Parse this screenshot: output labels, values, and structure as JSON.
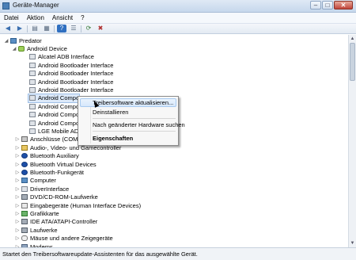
{
  "window": {
    "title": "Geräte-Manager",
    "min": "–",
    "max": "□",
    "close": "✕"
  },
  "menu": [
    "Datei",
    "Aktion",
    "Ansicht",
    "?"
  ],
  "toolbar": [
    "back-icon",
    "forward-icon",
    "view-icon",
    "properties-icon",
    "help-icon",
    "list-icon",
    "scan-icon",
    "uninstall-icon"
  ],
  "tree": {
    "root": "Predator",
    "android": {
      "label": "Android Device",
      "children": [
        "Alcatel ADB Interface",
        "Android Bootloader Interface",
        "Android Bootloader Interface",
        "Android Bootloader Interface",
        "Android Bootloader Interface",
        "Android Compo",
        "Android Compo",
        "Android Compo",
        "Android Compo",
        "LGE Mobile ADB"
      ],
      "selected_index": 5
    },
    "categories": [
      "Anschlüsse (COM & LPT)",
      "Audio-, Video- und Gamecontroller",
      "Bluetooth Auxiliary",
      "Bluetooth Virtual Devices",
      "Bluetooth-Funkgerät",
      "Computer",
      "DriverInterface",
      "DVD/CD-ROM-Laufwerke",
      "Eingabegeräte (Human Interface Devices)",
      "Grafikkarte",
      "IDE ATA/ATAPI-Controller",
      "Laufwerke",
      "Mäuse und andere Zeigegeräte",
      "Modems"
    ]
  },
  "context_menu": {
    "update_driver": "Treibersoftware aktualisieren...",
    "uninstall": "Deinstallieren",
    "scan": "Nach geänderter Hardware suchen",
    "properties": "Eigenschaften"
  },
  "status": "Startet den Treibersoftwareupdate-Assistenten für das ausgewählte Gerät."
}
